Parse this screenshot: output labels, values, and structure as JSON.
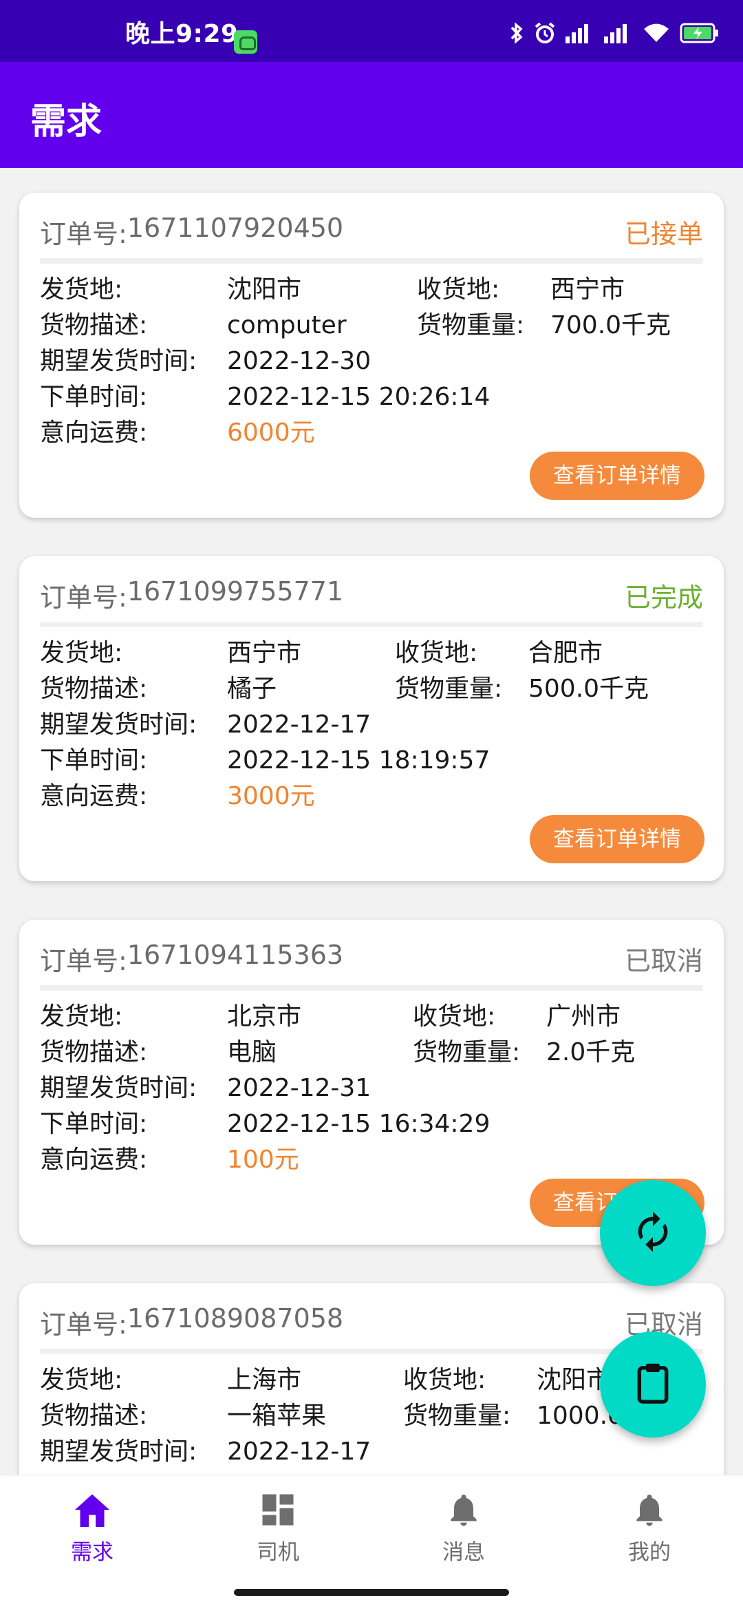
{
  "status_bar": {
    "time": "晚上9:29"
  },
  "app_bar": {
    "title": "需求"
  },
  "colors": {
    "primary": "#6200ee",
    "primary_dark": "#3700b3",
    "accent": "#03dac5",
    "orange": "#f08430",
    "green": "#6ab02f",
    "gray": "#7a7a7a"
  },
  "labels": {
    "order_no": "订单号:",
    "from": "发货地:",
    "to": "收货地:",
    "desc": "货物描述:",
    "weight": "货物重量:",
    "expected": "期望发货时间:",
    "ordered": "下单时间:",
    "fee": "意向运费:",
    "detail_button": "查看订单详情"
  },
  "orders": [
    {
      "order_no": "1671107920450",
      "status": "已接单",
      "status_color": "#f08430",
      "from": "沈阳市",
      "to": "西宁市",
      "desc": "computer",
      "weight": "700.0千克",
      "expected": "2022-12-30",
      "ordered": "2022-12-15 20:26:14",
      "fee": "6000元"
    },
    {
      "order_no": "1671099755771",
      "status": "已完成",
      "status_color": "#6ab02f",
      "from": "西宁市",
      "to": "合肥市",
      "desc": "橘子",
      "weight": "500.0千克",
      "expected": "2022-12-17",
      "ordered": "2022-12-15 18:19:57",
      "fee": "3000元"
    },
    {
      "order_no": "1671094115363",
      "status": "已取消",
      "status_color": "#7a7a7a",
      "from": "北京市",
      "to": "广州市",
      "desc": "电脑",
      "weight": "2.0千克",
      "expected": "2022-12-31",
      "ordered": "2022-12-15 16:34:29",
      "fee": "100元"
    },
    {
      "order_no": "1671089087058",
      "status": "已取消",
      "status_color": "#7a7a7a",
      "from": "上海市",
      "to": "沈阳市",
      "desc": "一箱苹果",
      "weight": "1000.0千克",
      "expected": "2022-12-17",
      "ordered": "",
      "fee": ""
    }
  ],
  "fabs": {
    "refresh_icon": "refresh-icon",
    "clipboard_icon": "clipboard-icon"
  },
  "bottom_nav": {
    "items": [
      {
        "label": "需求",
        "icon": "home-icon",
        "active": true
      },
      {
        "label": "司机",
        "icon": "dashboard-icon",
        "active": false
      },
      {
        "label": "消息",
        "icon": "bell-icon",
        "active": false
      },
      {
        "label": "我的",
        "icon": "bell-icon",
        "active": false
      }
    ]
  }
}
